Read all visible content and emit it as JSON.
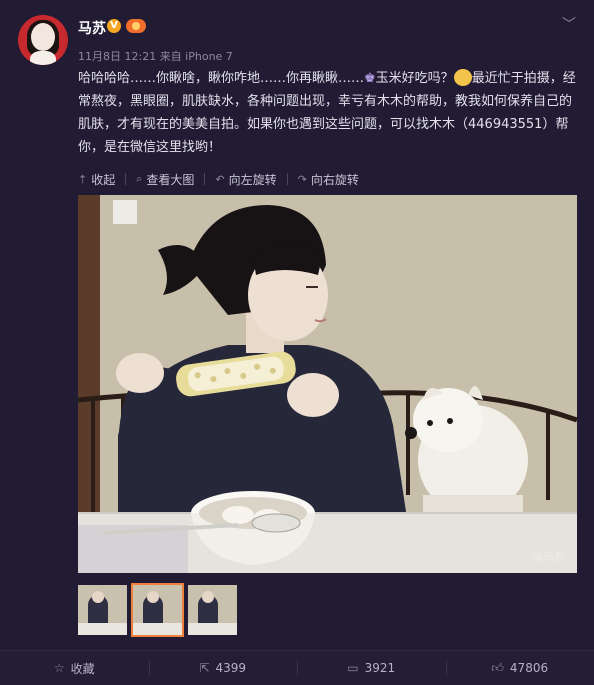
{
  "post": {
    "username": "马苏",
    "verified_badge": "V",
    "meta": "11月8日 12:21 来自 iPhone 7",
    "text_part1": "哈哈哈哈……你瞅啥，瞅你咋地……你再瞅瞅……",
    "text_crown": "♚",
    "text_part2": "玉米好吃吗？",
    "text_part3": "最近忙于拍摄，经常熬夜，黑眼圈，肌肤缺水，各种问题出现，幸亏有木木的帮助，教我如何保养自己的肌肤，才有现在的美美自拍。如果你也遇到这些问题，可以找木木（446943551）帮你，是在微信这里找哟！"
  },
  "media_actions": {
    "collapse": "收起",
    "view_large": "查看大图",
    "rotate_left": "向左旋转",
    "rotate_right": "向右旋转"
  },
  "photo": {
    "watermark": "@马苏"
  },
  "footer": {
    "favorite": "收藏",
    "repost_count": "4399",
    "comment_count": "3921",
    "like_count": "47806"
  },
  "icons": {
    "chevron": "chevron-down-icon",
    "favorite": "star-icon",
    "repost": "share-icon",
    "comment": "comment-icon",
    "like": "thumbs-up-icon"
  },
  "colors": {
    "background": "#211b33",
    "accent": "#ef7f3a",
    "text": "#e3e0ec"
  }
}
